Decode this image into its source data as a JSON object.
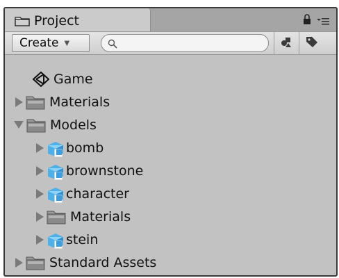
{
  "panel": {
    "tab_title": "Project",
    "tab_icon": "folder-icon"
  },
  "toolbar": {
    "create_label": "Create",
    "search_placeholder": "",
    "search_value": ""
  },
  "tree": [
    {
      "label": "Game",
      "icon": "unity-scene-icon",
      "expander": "none",
      "depth": 0
    },
    {
      "label": "Materials",
      "icon": "folder-icon",
      "expander": "collapsed",
      "depth": 0
    },
    {
      "label": "Models",
      "icon": "folder-icon",
      "expander": "expanded",
      "depth": 0
    },
    {
      "label": "bomb",
      "icon": "model-prefab-icon",
      "expander": "collapsed",
      "depth": 1
    },
    {
      "label": "brownstone",
      "icon": "model-prefab-icon",
      "expander": "collapsed",
      "depth": 1
    },
    {
      "label": "character",
      "icon": "model-prefab-icon",
      "expander": "collapsed",
      "depth": 1
    },
    {
      "label": "Materials",
      "icon": "folder-icon",
      "expander": "collapsed",
      "depth": 1
    },
    {
      "label": "stein",
      "icon": "model-prefab-icon",
      "expander": "collapsed",
      "depth": 1
    },
    {
      "label": "Standard Assets",
      "icon": "folder-icon",
      "expander": "collapsed",
      "depth": 0
    }
  ]
}
